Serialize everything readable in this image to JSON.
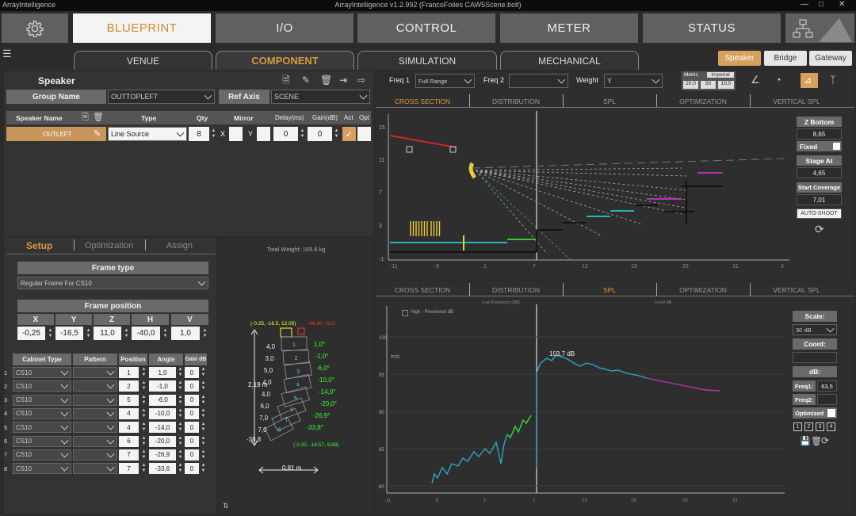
{
  "titlebar": {
    "logo": "ArrayIntelligence",
    "title": "ArrayIntelligence v1.2.992 (FrancoFolies CAW5Scene.bolt)"
  },
  "nav": {
    "tabs": [
      "BLUEPRINT",
      "I/O",
      "CONTROL",
      "METER",
      "STATUS"
    ],
    "active": "BLUEPRINT"
  },
  "subnav": {
    "tabs": [
      "VENUE",
      "COMPONENT",
      "SIMULATION",
      "MECHANICAL"
    ],
    "active": "COMPONENT"
  },
  "right_toggle": [
    "Speaker",
    "Bridge",
    "Gateway"
  ],
  "speaker_panel": {
    "title": "Speaker",
    "group_name_label": "Group Name",
    "group_name_value": "OUTTOPLEFT",
    "ref_axis_label": "Ref Axis",
    "ref_axis_value": "SCENE",
    "columns": [
      "Speaker Name",
      "Type",
      "Qty",
      "Mirror",
      "Delay(ms)",
      "Gain(dB)",
      "Act",
      "Opt"
    ],
    "row": {
      "name": "OUTLEFT",
      "type": "Line Source",
      "qty": "8",
      "mirror_x": "X",
      "mirror_y": "Y",
      "delay": "0",
      "gain": "0"
    }
  },
  "setup": {
    "tabs": [
      "Setup",
      "Optimization",
      "Assign"
    ],
    "frame_type_label": "Frame type",
    "frame_type_value": "Regular Frame For CS10",
    "frame_position_label": "Frame position",
    "pos_headers": [
      "X",
      "Y",
      "Z",
      "H",
      "V"
    ],
    "pos_values": [
      "-0,25",
      "-16,5",
      "11,0",
      "-40,0",
      "1,0"
    ],
    "cab_headers": [
      "Cabinet Type",
      "Pattern",
      "Position",
      "Angle",
      "Gain dB"
    ],
    "cabinets": [
      {
        "idx": "1",
        "type": "CS10",
        "pos": "1",
        "angle": "1,0",
        "gain": "0"
      },
      {
        "idx": "2",
        "type": "CS10",
        "pos": "2",
        "angle": "-1,0",
        "gain": "0"
      },
      {
        "idx": "3",
        "type": "CS10",
        "pos": "5",
        "angle": "-6,0",
        "gain": "0"
      },
      {
        "idx": "4",
        "type": "CS10",
        "pos": "4",
        "angle": "-10,0",
        "gain": "0"
      },
      {
        "idx": "5",
        "type": "CS10",
        "pos": "4",
        "angle": "-14,0",
        "gain": "0"
      },
      {
        "idx": "6",
        "type": "CS10",
        "pos": "6",
        "angle": "-20,0",
        "gain": "0"
      },
      {
        "idx": "7",
        "type": "CS10",
        "pos": "7",
        "angle": "-26,9",
        "gain": "0"
      },
      {
        "idx": "8",
        "type": "CS10",
        "pos": "7",
        "angle": "-33,6",
        "gain": "0"
      }
    ]
  },
  "array_view": {
    "total_weight": "Total Weight: 165.6 kg",
    "top_left": "(-0.25, -16.5, 12.05)",
    "top_right": "-46.40 -11.0",
    "height": "2,19 m",
    "width": "0,81 m",
    "bottom_coord": "(-0.32, -16.57, 9.88)",
    "left_labels": [
      "4,0",
      "3,0",
      "5,0",
      "4,0",
      "4,0",
      "6,0",
      "7,0",
      "7,0",
      "-38,8"
    ],
    "right_labels": [
      "1,0°",
      "-1,0°",
      "-6,0°",
      "-10,0°",
      "-14,0°",
      "-20,0°",
      "-26,9°",
      "-33,8°"
    ],
    "box_numbers": [
      "1",
      "2",
      "3",
      "4",
      "5",
      "6",
      "7",
      "8"
    ]
  },
  "freq_bar": {
    "freq1_label": "Freq 1",
    "freq1_value": "Full Range",
    "freq2_label": "Freq 2",
    "freq2_value": "",
    "weight_label": "Weight",
    "weight_value": "Y",
    "metric": "Metric",
    "imperial": "Imperial",
    "units": [
      "20,0",
      "50",
      "10,0"
    ]
  },
  "chart_tabs": [
    "CROSS SECTION",
    "DISTRIBUTION",
    "SPL",
    "OPTIMIZATION",
    "VERTICAL SPL"
  ],
  "cross_section": {
    "y_ticks": [
      "15",
      "11",
      "7",
      "3",
      "-1"
    ],
    "x_ticks": [
      "-11",
      "-5",
      "1",
      "7",
      "13",
      "19",
      "25",
      "31",
      "3"
    ],
    "z_bottom_label": "Z Bottom",
    "z_bottom_value": "8,65",
    "fixed_label": "Fixed",
    "stage_label": "Stage At",
    "stage_value": "4,65",
    "start_cov_label": "Start Coverage",
    "start_cov_value": "7,01",
    "autoshoot": "AUTO-SHOOT"
  },
  "spl_chart": {
    "legend_left": "High - Preserved dB",
    "legend_top_left": "Low frequency (dB)",
    "legend_top_right": "Level dB",
    "ylabel": "m/s",
    "y_ticks": [
      "100",
      "95",
      "90",
      "85",
      "80"
    ],
    "x_ticks": [
      "-11",
      "-5",
      "1",
      "7",
      "13",
      "19",
      "25",
      "31"
    ],
    "peak_label": "103,7 dB",
    "scale_label": "Scale:",
    "scale_value": "30 dB",
    "coord_label": "Coord:",
    "db_label": "dB:",
    "freq1_label": "Freq1:",
    "freq1_value": "63,5",
    "freq2_label": "Freq2:",
    "optimized_label": "Optimized",
    "presets": [
      "1",
      "2",
      "3",
      "4"
    ]
  },
  "colors": {
    "accent": "#d89a40",
    "header": "#6a6a6a",
    "panel": "#333333"
  }
}
